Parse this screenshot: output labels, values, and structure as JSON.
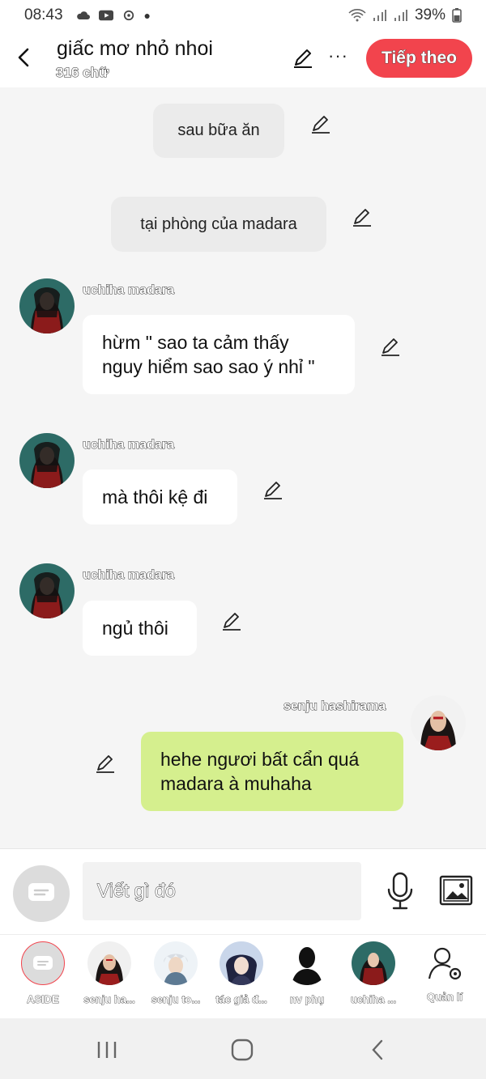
{
  "status_bar": {
    "time": "08:43",
    "battery": "39%"
  },
  "header": {
    "title": "giấc mơ nhỏ nhoi",
    "subtitle": "316 chữ",
    "next_label": "Tiếp theo",
    "more_label": "···"
  },
  "messages": [
    {
      "type": "narration",
      "text": "sau bữa ăn"
    },
    {
      "type": "narration",
      "text": "tại phòng của madara"
    },
    {
      "type": "left",
      "name": "uchiha madara",
      "lines": [
        "hừm \" sao ta cảm thấy",
        "nguy hiểm sao sao ý nhỉ \""
      ]
    },
    {
      "type": "left",
      "name": "uchiha madara",
      "lines": [
        "mà thôi kệ đi"
      ]
    },
    {
      "type": "left",
      "name": "uchiha madara",
      "lines": [
        "ngủ thôi"
      ]
    },
    {
      "type": "right",
      "name": "senju hashirama",
      "lines": [
        "hehe ngươi bất cẩn quá",
        "madara à muhaha"
      ]
    }
  ],
  "input": {
    "placeholder": "Viết gì đó"
  },
  "characters": [
    {
      "label": "ASIDE"
    },
    {
      "label": "senju ha..."
    },
    {
      "label": "senju to..."
    },
    {
      "label": "tác giả đ..."
    },
    {
      "label": "nv phụ"
    },
    {
      "label": "uchiha ..."
    },
    {
      "label": "Quản lí"
    }
  ],
  "colors": {
    "accent": "#f2444d",
    "my_bubble": "#d5ef8e"
  }
}
